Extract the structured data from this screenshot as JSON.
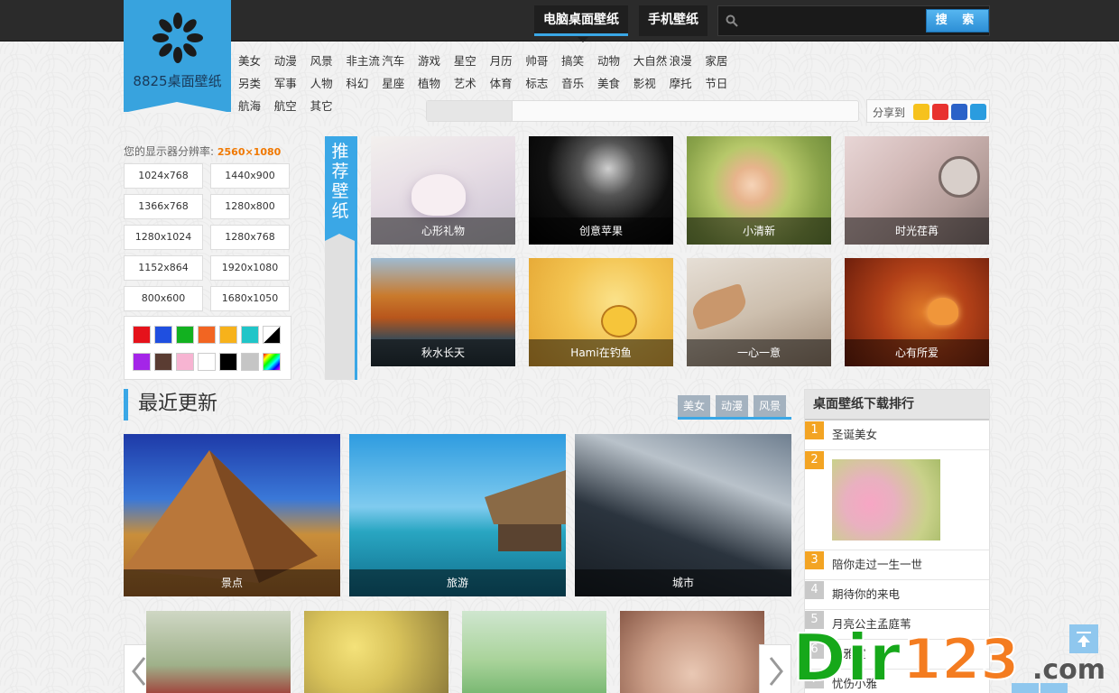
{
  "site": {
    "logo_text": "8825桌面壁纸"
  },
  "nav": {
    "tabs": [
      {
        "label": "电脑桌面壁纸",
        "active": true
      },
      {
        "label": "手机壁纸",
        "active": false
      }
    ]
  },
  "search": {
    "placeholder": "",
    "button_label": "搜 索"
  },
  "categories": [
    "美女",
    "动漫",
    "风景",
    "非主流",
    "汽车",
    "游戏",
    "星空",
    "月历",
    "帅哥",
    "搞笑",
    "动物",
    "大自然",
    "浪漫",
    "家居",
    "另类",
    "军事",
    "人物",
    "科幻",
    "星座",
    "植物",
    "艺术",
    "体育",
    "标志",
    "音乐",
    "美食",
    "影视",
    "摩托",
    "节日",
    "航海",
    "航空",
    "其它"
  ],
  "share": {
    "label": "分享到",
    "icons": [
      "qzone-icon",
      "weibo-icon",
      "baidu-icon",
      "pengyou-icon"
    ]
  },
  "resolution": {
    "label": "您的显示器分辨率:",
    "value": "2560×1080",
    "options": [
      "1024x768",
      "1440x900",
      "1366x768",
      "1280x800",
      "1280x1024",
      "1280x768",
      "1152x864",
      "1920x1080",
      "800x600",
      "1680x1050"
    ]
  },
  "colors": [
    "#e5121b",
    "#1f4fe0",
    "#12b120",
    "#f26522",
    "#f7b21b",
    "#20c5c8",
    "diagonal",
    "#a425e8",
    "#5a3c32",
    "#f7b4d2",
    "#ffffff",
    "#000000",
    "#c5c5c5",
    "rainbow"
  ],
  "recommend": {
    "tag": "推荐壁纸",
    "items": [
      "心形礼物",
      "创意苹果",
      "小清新",
      "时光荏苒",
      "秋水长天",
      "Hami在钓鱼",
      "一心一意",
      "心有所爱"
    ]
  },
  "latest": {
    "title": "最近更新",
    "tabs": [
      "美女",
      "动漫",
      "风景"
    ],
    "items": [
      "景点",
      "旅游",
      "城市"
    ]
  },
  "ranking": {
    "title": "桌面壁纸下载排行",
    "items": [
      {
        "num": "1",
        "title": "圣诞美女"
      },
      {
        "num": "2",
        "title": ""
      },
      {
        "num": "3",
        "title": "陪你走过一生一世"
      },
      {
        "num": "4",
        "title": "期待你的来电"
      },
      {
        "num": "5",
        "title": "月亮公主孟庭苇"
      },
      {
        "num": "6",
        "title": "淡雅室"
      },
      {
        "num": "7",
        "title": "忧伤小雅"
      }
    ]
  },
  "watermark": {
    "text_a": "Dir",
    "text_b": "123",
    "text_c": ".com"
  }
}
